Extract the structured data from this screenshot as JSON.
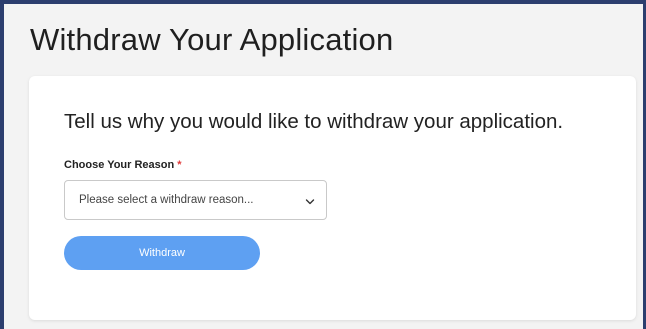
{
  "page": {
    "title": "Withdraw Your Application"
  },
  "form": {
    "heading": "Tell us why you would like to withdraw your application.",
    "reason_label": "Choose Your Reason",
    "required_marker": "*",
    "reason_select": {
      "selected_value": "Please select a withdraw reason..."
    },
    "submit_label": "Withdraw"
  },
  "colors": {
    "frame_border": "#2c3e6e",
    "button": "#5ea0f2",
    "required": "#e03a3a"
  },
  "icons": {
    "select_arrow": "chevron-down-icon"
  }
}
